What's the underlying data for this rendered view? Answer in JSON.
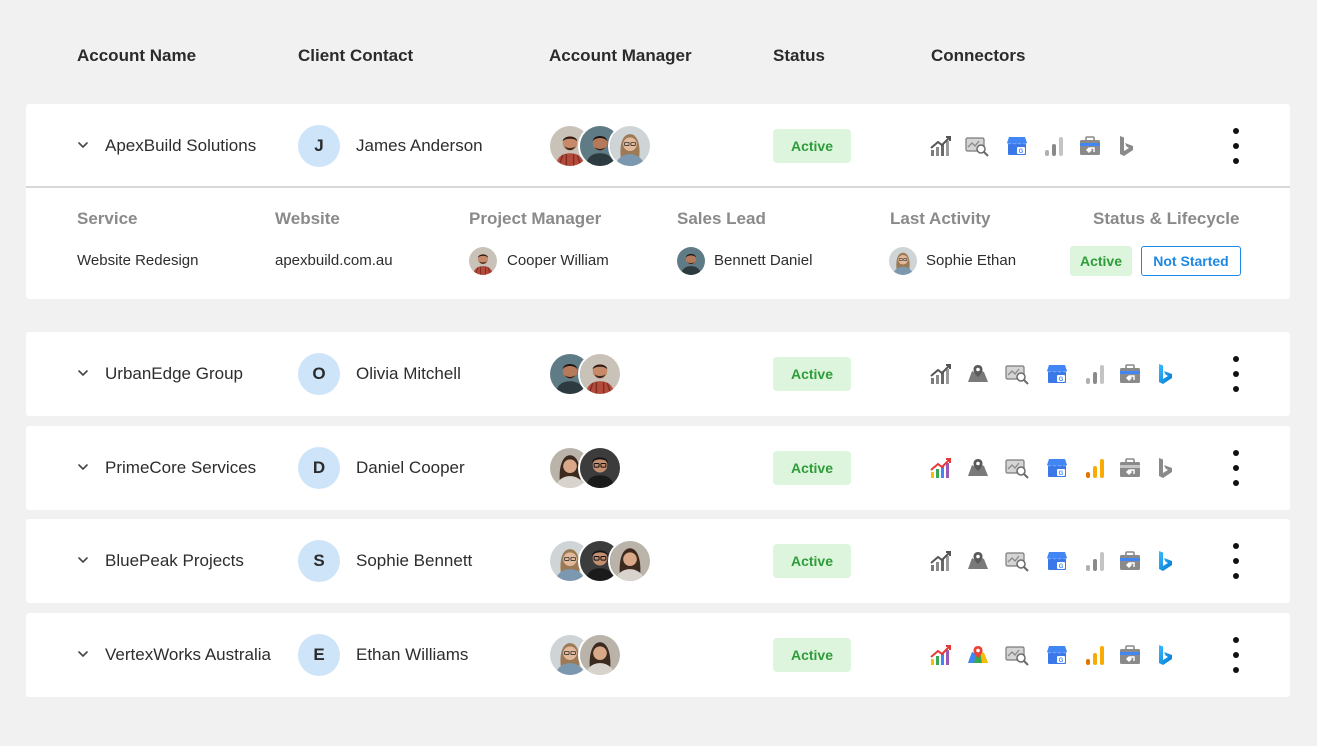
{
  "columns": {
    "account_name": "Account Name",
    "client_contact": "Client Contact",
    "account_manager": "Account Manager",
    "status": "Status",
    "connectors": "Connectors"
  },
  "accounts": [
    {
      "name": "ApexBuild Solutions",
      "initial": "J",
      "contact": "James Anderson",
      "status": "Active",
      "managers": [
        "man-plaid-shirt",
        "man-dark-shirt",
        "woman-glasses"
      ],
      "connectors": [
        "growth-chart-icon",
        "search-console-icon",
        "google-business-icon",
        "analytics-bars-icon",
        "tag-manager-icon",
        "bing-icon"
      ],
      "expanded": true
    },
    {
      "name": "UrbanEdge Group",
      "initial": "O",
      "contact": "Olivia Mitchell",
      "status": "Active",
      "managers": [
        "man-dark-shirt",
        "man-plaid-shirt"
      ],
      "connectors": [
        "growth-chart-icon",
        "maps-pin-icon",
        "search-console-icon",
        "google-business-icon",
        "analytics-bars-icon",
        "tag-manager-icon",
        "bing-icon"
      ]
    },
    {
      "name": "PrimeCore Services",
      "initial": "D",
      "contact": "Daniel Cooper",
      "status": "Active",
      "managers": [
        "woman-long-hair",
        "man-glasses"
      ],
      "connectors": [
        "growth-chart-icon",
        "maps-pin-icon",
        "search-console-icon",
        "google-business-icon",
        "analytics-bars-icon",
        "tag-manager-icon",
        "bing-icon"
      ]
    },
    {
      "name": "BluePeak Projects",
      "initial": "S",
      "contact": "Sophie Bennett",
      "status": "Active",
      "managers": [
        "woman-glasses",
        "man-glasses",
        "woman-long-hair"
      ],
      "connectors": [
        "growth-chart-icon",
        "maps-pin-icon",
        "search-console-icon",
        "google-business-icon",
        "analytics-bars-icon",
        "tag-manager-icon",
        "bing-icon"
      ]
    },
    {
      "name": "VertexWorks Australia",
      "initial": "E",
      "contact": "Ethan Williams",
      "status": "Active",
      "managers": [
        "woman-glasses",
        "woman-long-hair"
      ],
      "connectors": [
        "growth-chart-icon",
        "maps-pin-icon",
        "search-console-icon",
        "google-business-icon",
        "analytics-bars-icon",
        "tag-manager-icon",
        "bing-icon"
      ]
    }
  ],
  "detail": {
    "headers": {
      "service": "Service",
      "website": "Website",
      "project_manager": "Project Manager",
      "sales_lead": "Sales Lead",
      "last_activity": "Last Activity",
      "status_lifecycle": "Status & Lifecycle"
    },
    "service": "Website Redesign",
    "website": "apexbuild.com.au",
    "project_manager": "Cooper William",
    "sales_lead": "Bennett Daniel",
    "last_activity": "Sophie Ethan",
    "status": "Active",
    "lifecycle": "Not Started"
  },
  "colors": {
    "active_bg": "#dcf5dc",
    "active_text": "#2f9c3a",
    "avatar_bg": "#cde4f9",
    "accent_blue": "#1e88e5"
  }
}
